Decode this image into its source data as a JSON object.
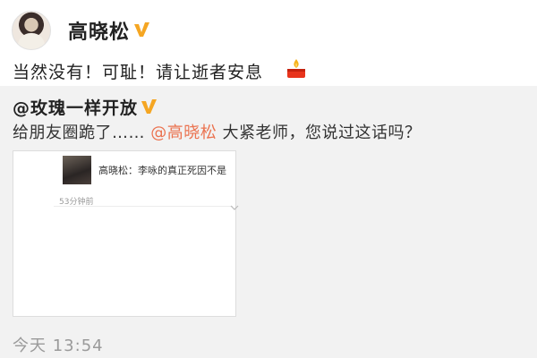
{
  "post": {
    "author": "高晓松",
    "text": "当然没有！可耻！请让逝者安息",
    "timestamp": "今天 13:54"
  },
  "repost": {
    "author": "@玫瑰一样开放",
    "text_before": "给朋友圈跪了…… ",
    "mention": "@高晓松",
    "text_after": " 大紧老师，您说过这话吗？",
    "card": {
      "text": "高晓松：李咏的真正死因不是",
      "time": "53分钟前"
    }
  },
  "colors": {
    "mention": "#eb7350",
    "verified_badge": "#f5a623",
    "repost_background": "#f2f2f2"
  },
  "icons": {
    "verified": "verified-badge-icon",
    "candle": "candle-icon"
  }
}
